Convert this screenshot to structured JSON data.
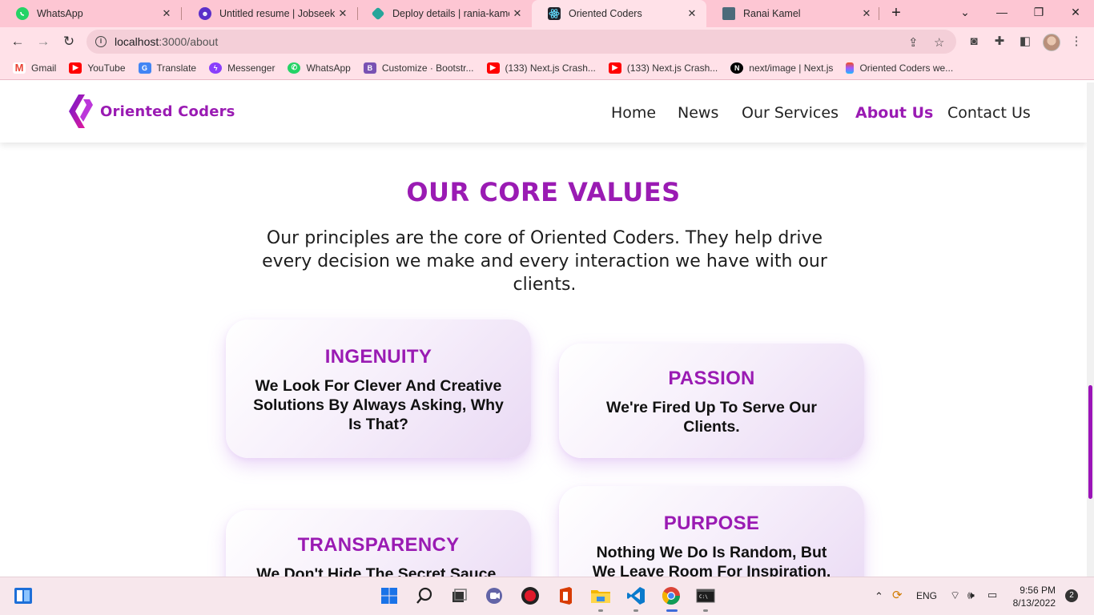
{
  "browser": {
    "tabs": [
      {
        "title": "WhatsApp",
        "icon": "whatsapp-icon",
        "active": false
      },
      {
        "title": "Untitled resume | Jobseeker",
        "icon": "jobseeker-icon",
        "active": false
      },
      {
        "title": "Deploy details | rania-kamel-",
        "icon": "netlify-icon",
        "active": false
      },
      {
        "title": "Oriented Coders",
        "icon": "react-icon",
        "active": true
      },
      {
        "title": "Ranai Kamel",
        "icon": "portfolio-icon",
        "active": false
      }
    ],
    "url_host": "localhost",
    "url_path": ":3000/about",
    "bookmarks": [
      {
        "label": "Gmail",
        "icon": "gmail-icon",
        "color": "#ea4335"
      },
      {
        "label": "YouTube",
        "icon": "youtube-icon",
        "color": "#ff0000"
      },
      {
        "label": "Translate",
        "icon": "translate-icon",
        "color": "#4285f4"
      },
      {
        "label": "Messenger",
        "icon": "messenger-icon",
        "color": "#8a3ffc"
      },
      {
        "label": "WhatsApp",
        "icon": "whatsapp-icon",
        "color": "#25d366"
      },
      {
        "label": "Customize · Bootstr...",
        "icon": "bootstrap-icon",
        "color": "#7952b3"
      },
      {
        "label": "(133) Next.js Crash...",
        "icon": "youtube-icon",
        "color": "#ff0000"
      },
      {
        "label": "(133) Next.js Crash...",
        "icon": "youtube-icon",
        "color": "#ff0000"
      },
      {
        "label": "next/image | Next.js",
        "icon": "nextjs-icon",
        "color": "#000000"
      },
      {
        "label": "Oriented Coders we...",
        "icon": "figma-icon",
        "color": "#f24e1e"
      }
    ]
  },
  "site": {
    "brand": "Oriented Coders",
    "accent_color": "#9a1bb3",
    "nav": [
      {
        "label": "Home",
        "active": false
      },
      {
        "label": "News",
        "active": false
      },
      {
        "label": "Our Services",
        "active": false
      },
      {
        "label": "About Us",
        "active": true
      },
      {
        "label": "Contact Us",
        "active": false
      }
    ],
    "heading": "OUR CORE VALUES",
    "subtitle": "Our principles are the core of Oriented Coders. They help drive every decision we make and every interaction we have with our clients.",
    "values": [
      {
        "title": "INGENUITY",
        "text": "We Look For Clever And Creative Solutions By Always Asking, Why Is That?"
      },
      {
        "title": "PASSION",
        "text": "We're Fired Up To Serve Our Clients."
      },
      {
        "title": "TRANSPARENCY",
        "text": "We Don't Hide The Secret Sauce."
      },
      {
        "title": "PURPOSE",
        "text": "Nothing We Do Is Random, But We Leave Room For Inspiration."
      }
    ]
  },
  "taskbar": {
    "language": "ENG",
    "time": "9:56 PM",
    "date": "8/13/2022",
    "notifications": "2"
  }
}
